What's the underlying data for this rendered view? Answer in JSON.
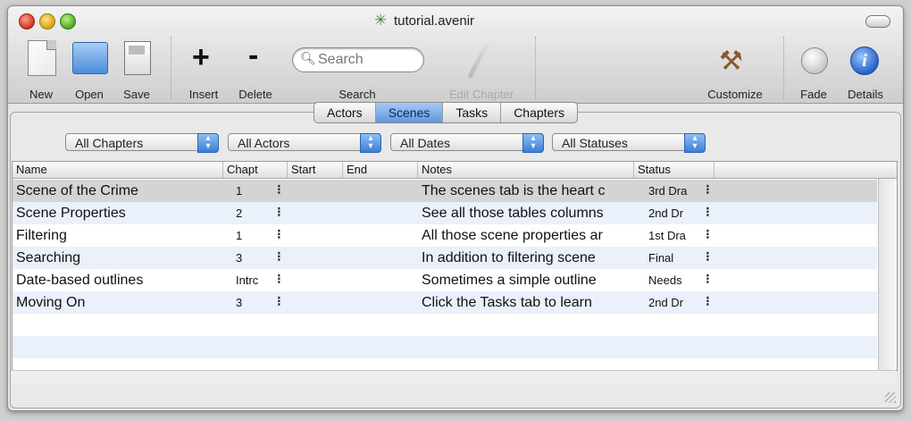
{
  "window": {
    "title": "tutorial.avenir",
    "title_icon": "leaf-icon"
  },
  "toolbar": {
    "new_label": "New",
    "open_label": "Open",
    "save_label": "Save",
    "insert_label": "Insert",
    "delete_label": "Delete",
    "search_label": "Search",
    "search_placeholder": "Search",
    "edit_chapter_label": "Edit Chapter",
    "customize_label": "Customize",
    "fade_label": "Fade",
    "details_label": "Details"
  },
  "tabs": [
    {
      "label": "Actors",
      "active": false
    },
    {
      "label": "Scenes",
      "active": true
    },
    {
      "label": "Tasks",
      "active": false
    },
    {
      "label": "Chapters",
      "active": false
    }
  ],
  "filters": {
    "chapters": "All Chapters",
    "actors": "All Actors",
    "dates": "All Dates",
    "statuses": "All Statuses"
  },
  "table": {
    "columns": [
      "Name",
      "Chapt",
      "Start",
      "End",
      "Notes",
      "Status"
    ],
    "rows": [
      {
        "name": "Scene of the Crime",
        "chapter": "1",
        "start": "",
        "end": "",
        "notes": "The scenes tab is the heart c",
        "status": "3rd Dra"
      },
      {
        "name": "Scene Properties",
        "chapter": "2",
        "start": "",
        "end": "",
        "notes": "See all those tables columns",
        "status": "2nd Dr"
      },
      {
        "name": "Filtering",
        "chapter": "1",
        "start": "",
        "end": "",
        "notes": "All those scene properties ar",
        "status": "1st Dra"
      },
      {
        "name": "Searching",
        "chapter": "3",
        "start": "",
        "end": "",
        "notes": "In addition to filtering scene",
        "status": "Final"
      },
      {
        "name": "Date-based outlines",
        "chapter": "Intrc",
        "start": "",
        "end": "",
        "notes": "Sometimes a simple outline",
        "status": "Needs"
      },
      {
        "name": "Moving On",
        "chapter": "3",
        "start": "",
        "end": "",
        "notes": "Click the Tasks tab to learn",
        "status": "2nd Dr"
      }
    ]
  },
  "colors": {
    "selected_tab": "#6aa0e4",
    "alt_row": "#eaf1fb",
    "selected_row": "#d4d4d4",
    "popup_arrow": "#3c7fd6"
  }
}
